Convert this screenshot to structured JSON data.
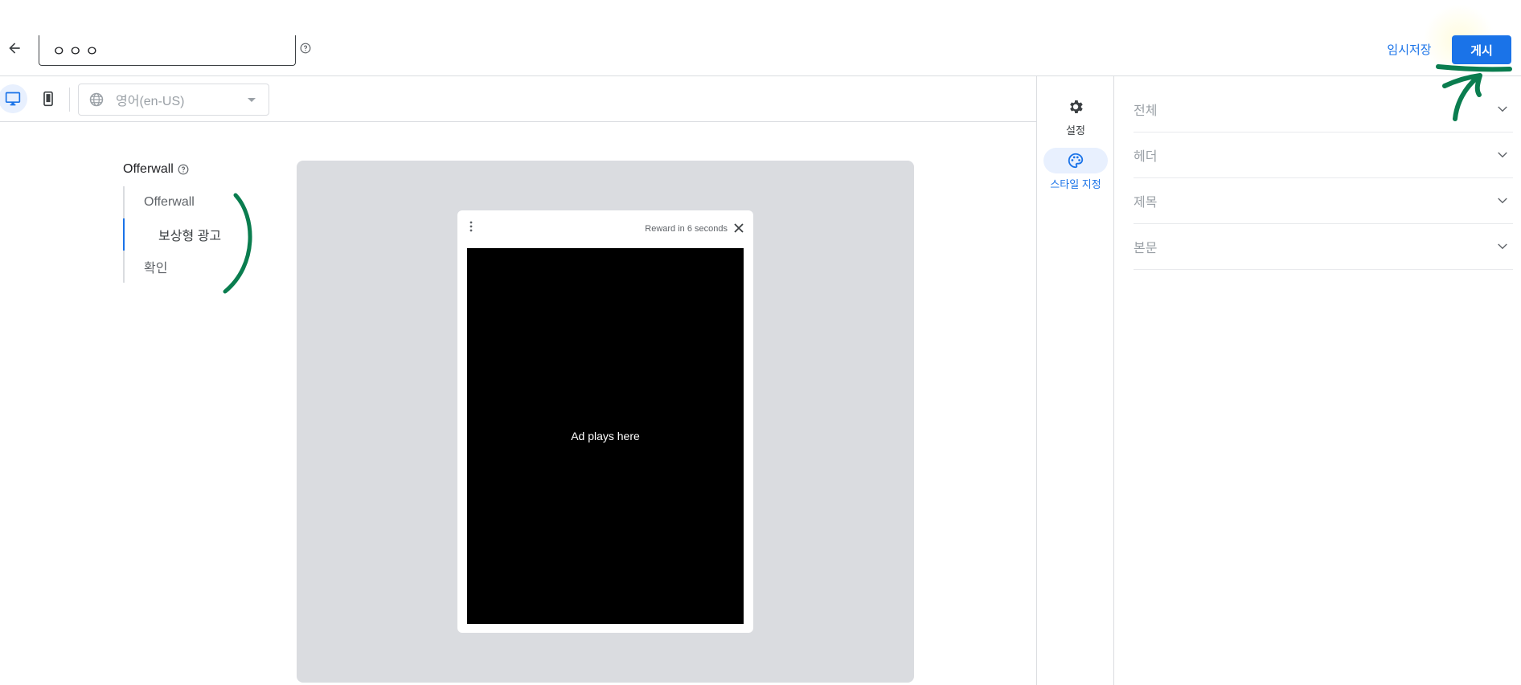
{
  "header": {
    "title_value": "ㅇㅇㅇ",
    "draft_label": "임시저장",
    "publish_label": "게시"
  },
  "toolbar": {
    "language": "영어(en-US)"
  },
  "nav": {
    "title": "Offerwall",
    "items": [
      {
        "label": "Offerwall"
      },
      {
        "label": "보상형 광고"
      },
      {
        "label": "확인"
      }
    ]
  },
  "preview": {
    "reward_text": "Reward in 6 seconds",
    "ad_text": "Ad plays here"
  },
  "rail": {
    "items": [
      {
        "label": "설정",
        "icon": "gear-icon"
      },
      {
        "label": "스타일 지정",
        "icon": "palette-icon"
      }
    ]
  },
  "panel": {
    "sections": [
      {
        "label": "전체"
      },
      {
        "label": "헤더"
      },
      {
        "label": "제목"
      },
      {
        "label": "본문"
      }
    ]
  },
  "colors": {
    "accent": "#1a73e8",
    "annotation": "#0a7d4f"
  }
}
